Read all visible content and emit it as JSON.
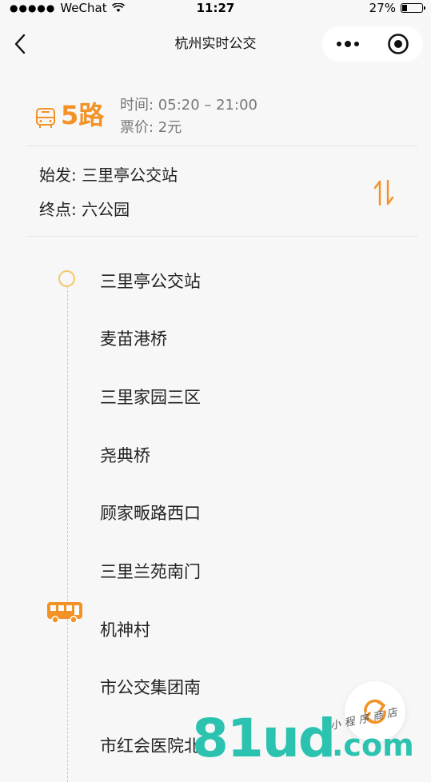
{
  "status_bar": {
    "carrier": "WeChat",
    "signal": "●●●●●",
    "time": "11:27",
    "battery": "27%"
  },
  "navbar": {
    "title": "杭州实时公交"
  },
  "route": {
    "name": "5路",
    "time_label": "时间: 05:20 – 21:00",
    "price_label": "票价: 2元",
    "start_label": "始发: 三里亭公交站",
    "end_label": "终点: 六公园"
  },
  "stops": [
    "三里亭公交站",
    "麦苗港桥",
    "三里家园三区",
    "尧典桥",
    "顾家畈路西口",
    "三里兰苑南门",
    "机神村",
    "市公交集团南",
    "市红会医院北"
  ],
  "watermark": {
    "main": "81ud",
    "suffix": ".com",
    "tag": "小程序商店"
  },
  "colors": {
    "accent": "#f39227",
    "start_dot": "#f6c66a",
    "watermark": "#2bc3b0"
  }
}
